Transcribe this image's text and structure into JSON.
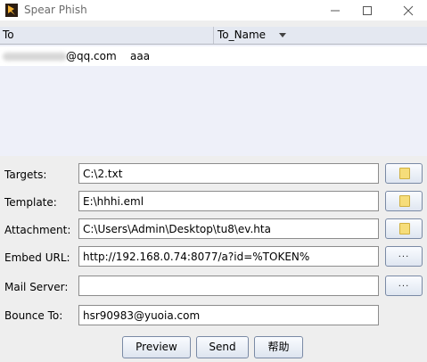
{
  "window": {
    "title": "Spear Phish",
    "min_icon": "minimize-icon",
    "max_icon": "maximize-icon",
    "close_icon": "close-icon"
  },
  "table": {
    "columns": [
      "To",
      "To_Name"
    ],
    "rows": [
      {
        "email": "@qq.com",
        "name": "aaa"
      }
    ]
  },
  "form": {
    "targets_label": "Targets:",
    "targets_value": "C:\\2.txt",
    "template_label": "Template:",
    "template_value": "E:\\hhhi.eml",
    "attachment_label": "Attachment:",
    "attachment_value": "C:\\Users\\Admin\\Desktop\\tu8\\ev.hta",
    "embed_label": "Embed URL:",
    "embed_value": "http://192.168.0.74:8077/a?id=%TOKEN%",
    "mailserver_label": "Mail Server:",
    "mailserver_value": "",
    "bounce_label": "Bounce To:",
    "bounce_value": "hsr90983@yuoia.com",
    "dots_label": "..."
  },
  "buttons": {
    "preview": "Preview",
    "send": "Send",
    "help": "帮助"
  }
}
